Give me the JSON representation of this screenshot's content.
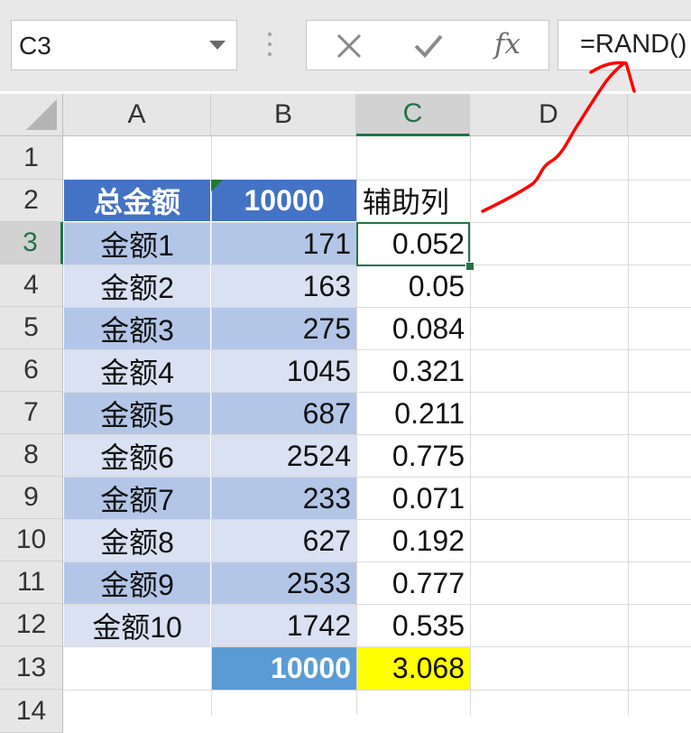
{
  "formula_bar": {
    "name_box": "C3",
    "cancel_icon": "cancel-icon",
    "enter_icon": "check-icon",
    "fx_label": "fx",
    "formula": "=RAND()"
  },
  "columns": [
    "A",
    "B",
    "C",
    "D"
  ],
  "rows": [
    "1",
    "2",
    "3",
    "4",
    "5",
    "6",
    "7",
    "8",
    "9",
    "10",
    "11",
    "12",
    "13",
    "14"
  ],
  "header_row": {
    "a": "总金额",
    "b": "10000",
    "c": "辅助列"
  },
  "data_rows": [
    {
      "a": "金额1",
      "b": "171",
      "c": "0.052"
    },
    {
      "a": "金额2",
      "b": "163",
      "c": "0.05"
    },
    {
      "a": "金额3",
      "b": "275",
      "c": "0.084"
    },
    {
      "a": "金额4",
      "b": "1045",
      "c": "0.321"
    },
    {
      "a": "金额5",
      "b": "687",
      "c": "0.211"
    },
    {
      "a": "金额6",
      "b": "2524",
      "c": "0.775"
    },
    {
      "a": "金额7",
      "b": "233",
      "c": "0.071"
    },
    {
      "a": "金额8",
      "b": "627",
      "c": "0.192"
    },
    {
      "a": "金额9",
      "b": "2533",
      "c": "0.777"
    },
    {
      "a": "金额10",
      "b": "1742",
      "c": "0.535"
    }
  ],
  "total_row": {
    "b": "10000",
    "c": "3.068"
  },
  "colors": {
    "header_fill": "#4472c4",
    "band_dark": "#b4c6e7",
    "band_light": "#d9e1f2",
    "total_b_fill": "#5b9bd5",
    "total_c_fill": "#ffff00",
    "selection": "#217346",
    "annotation": "#ff0000"
  }
}
